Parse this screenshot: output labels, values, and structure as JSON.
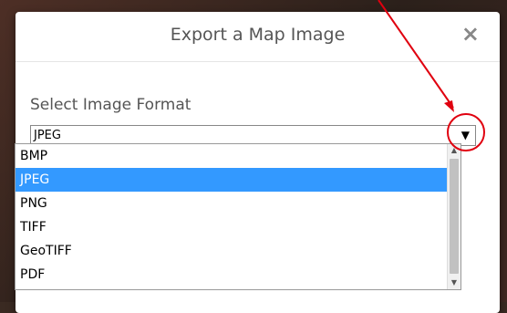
{
  "dialog": {
    "title": "Export a Map Image",
    "close_label": "×"
  },
  "form": {
    "label": "Select Image Format",
    "selected_value": "JPEG",
    "arrow_glyph": "▼"
  },
  "options": [
    "BMP",
    "JPEG",
    "PNG",
    "TIFF",
    "GeoTIFF",
    "PDF"
  ],
  "selected_index": 1,
  "colors": {
    "selected_bg": "#3399ff",
    "annotation": "#e0000f"
  }
}
